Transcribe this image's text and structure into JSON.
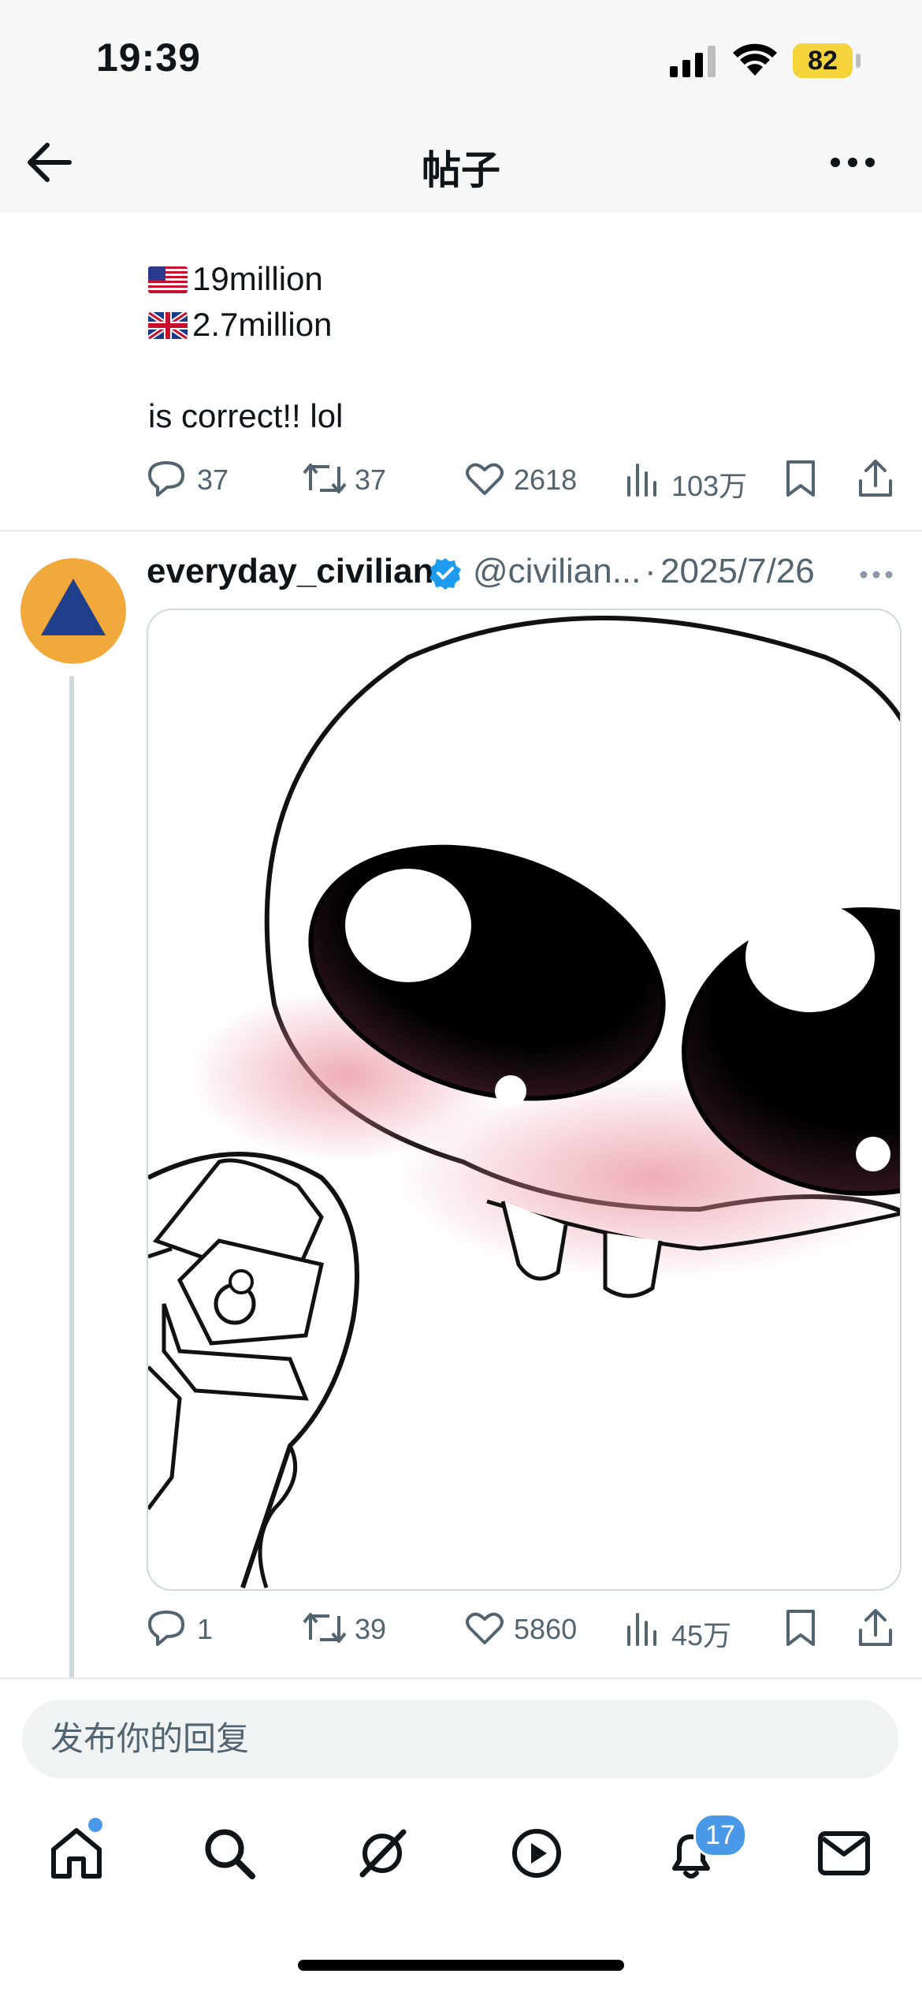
{
  "status_bar": {
    "time": "19:39",
    "battery": "82"
  },
  "header": {
    "title": "帖子"
  },
  "post1": {
    "lines": [
      {
        "flag": "us",
        "text": "19million"
      },
      {
        "flag": "uk",
        "text": "2.7million"
      }
    ],
    "body": "is correct!! lol",
    "actions": {
      "replies": "37",
      "reposts": "37",
      "likes": "2618",
      "views": "103万"
    }
  },
  "post2": {
    "author": "everyday_civilian",
    "handle": "@civilian...",
    "separator": "·",
    "date": "2025/7/26",
    "actions": {
      "replies": "1",
      "reposts": "39",
      "likes": "5860",
      "views": "45万"
    }
  },
  "reply": {
    "placeholder": "发布你的回复"
  },
  "tabbar": {
    "notifications_badge": "17"
  },
  "colors": {
    "accent": "#4a99e9",
    "avatar_bg": "#f0a93a",
    "avatar_triangle": "#1f3f8a",
    "battery": "#f5d33a"
  }
}
